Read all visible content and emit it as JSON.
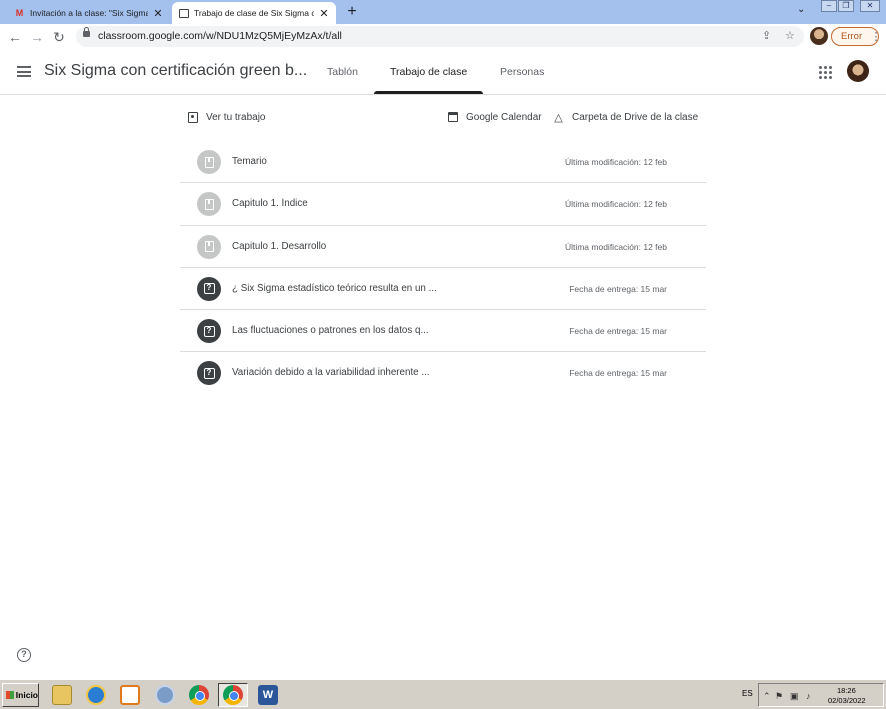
{
  "browser": {
    "tabs": [
      {
        "title": "Invitación a la clase: \"Six Sigma con c",
        "icon": "gmail-icon",
        "active": false
      },
      {
        "title": "Trabajo de clase de Six Sigma con ce",
        "icon": "classroom-icon",
        "active": true
      }
    ],
    "new_tab": "+",
    "tab_search": "⌄",
    "window_controls": {
      "minimize": "–",
      "maximize": "❐",
      "close": "✕"
    },
    "url": "classroom.google.com/w/NDU1MzQ5MjEyMzAx/t/all",
    "error_label": "Error"
  },
  "classroom": {
    "class_title": "Six Sigma con certificación green b...",
    "nav": {
      "stream": "Tablón",
      "classwork": "Trabajo de clase",
      "people": "Personas"
    }
  },
  "actions": {
    "view_work": "Ver tu trabajo",
    "calendar": "Google Calendar",
    "drive": "Carpeta de Drive de la clase"
  },
  "items": [
    {
      "type": "material",
      "title": "Temario",
      "date": "Última modificación: 12 feb"
    },
    {
      "type": "material",
      "title": "Capitulo 1. Índice",
      "date": "Última modificación: 12 feb"
    },
    {
      "type": "material",
      "title": "Capitulo 1. Desarrollo",
      "date": "Última modificación: 12 feb"
    },
    {
      "type": "question",
      "title": "¿ Six Sigma estadístico teórico resulta en un ...",
      "date": "Fecha de entrega: 15 mar"
    },
    {
      "type": "question",
      "title": "Las fluctuaciones o patrones en los datos q...",
      "date": "Fecha de entrega: 15 mar"
    },
    {
      "type": "question",
      "title": "Variación debido a la variabilidad inherente ...",
      "date": "Fecha de entrega: 15 mar"
    }
  ],
  "help": "?",
  "taskbar": {
    "start_label": "Inicio",
    "language": "ES",
    "time": "18:26",
    "date": "02/03/2022"
  },
  "colors": {
    "tabstrip": "#a4c1ee",
    "accent_underline": "#1f1f1f",
    "error": "#b0541b"
  }
}
